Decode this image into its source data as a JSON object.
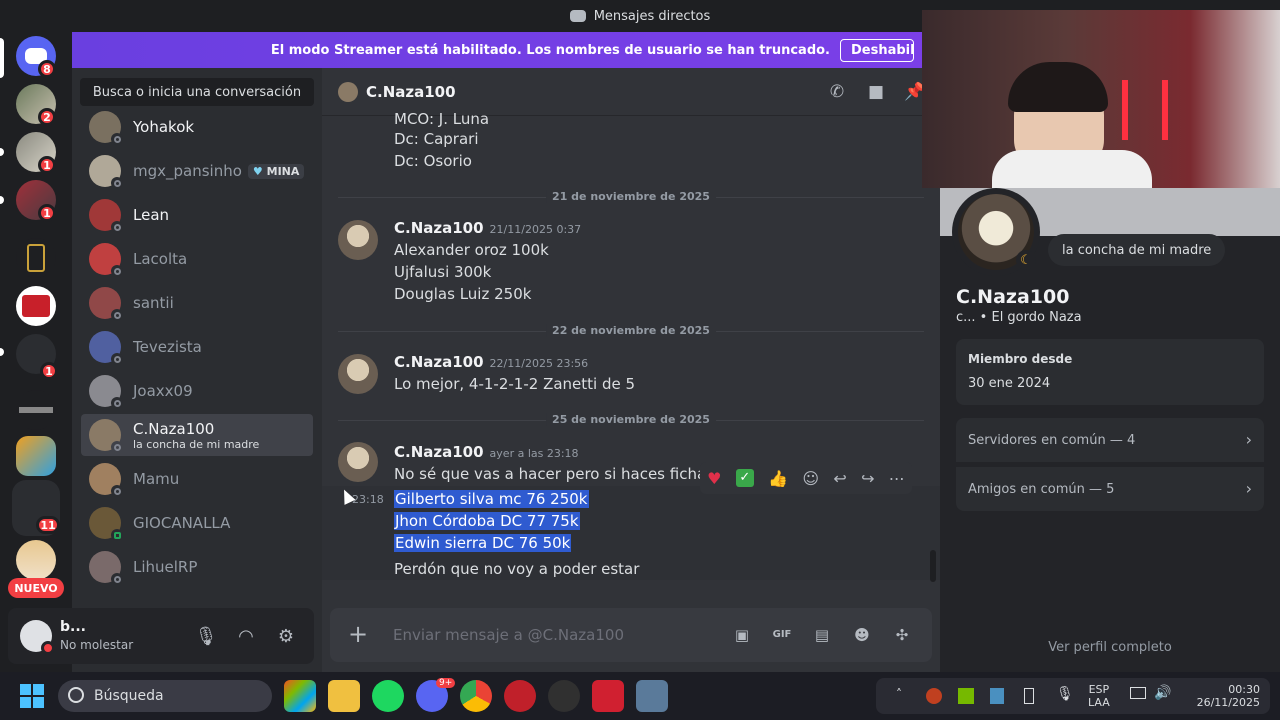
{
  "window": {
    "title": "Mensajes directos"
  },
  "banner": {
    "text": "El modo Streamer está habilitado. Los nombres de usuario se han truncado.",
    "button": "Deshabilit"
  },
  "rail": {
    "badges": [
      "8",
      "2",
      "1",
      "1",
      "1",
      "11"
    ],
    "nuevo": "NUEVO"
  },
  "sidebar": {
    "search_placeholder": "Busca o inicia una conversación",
    "dms": [
      {
        "name": "Yohakok",
        "sub": "",
        "badge": ""
      },
      {
        "name": "mgx_pansinho",
        "sub": "",
        "badge": "MINA"
      },
      {
        "name": "Lean",
        "sub": "",
        "badge": ""
      },
      {
        "name": "Lacolta",
        "sub": "",
        "badge": ""
      },
      {
        "name": "santii",
        "sub": "",
        "badge": ""
      },
      {
        "name": "Tevezista",
        "sub": "",
        "badge": ""
      },
      {
        "name": "Joaxx09",
        "sub": "",
        "badge": ""
      },
      {
        "name": "C.Naza100",
        "sub": "la concha de mi madre",
        "badge": ""
      },
      {
        "name": "Mamu",
        "sub": "",
        "badge": ""
      },
      {
        "name": "GIOCANALLA",
        "sub": "",
        "badge": ""
      },
      {
        "name": "LihuelRP",
        "sub": "",
        "badge": ""
      }
    ],
    "user": {
      "name": "b...",
      "status": "No molestar"
    }
  },
  "chat": {
    "header_name": "C.Naza100",
    "top_lines": [
      "MCO: J. Luna",
      "Dc: Caprari",
      "Dc: Osorio"
    ],
    "dividers": [
      "21 de noviembre de 2025",
      "22 de noviembre de 2025",
      "25 de noviembre de 2025"
    ],
    "messages": [
      {
        "author": "C.Naza100",
        "time": "21/11/2025 0:37",
        "lines": [
          "Alexander oroz 100k",
          "Ujfalusi 300k",
          "Douglas Luiz 250k"
        ]
      },
      {
        "author": "C.Naza100",
        "time": "22/11/2025 23:56",
        "lines": [
          "Lo mejor, 4-1-2-1-2 Zanetti de 5"
        ]
      },
      {
        "author": "C.Naza100",
        "time": "ayer a las 23:18",
        "lines": [
          "No sé que vas a hacer pero si haces fichajes a"
        ]
      }
    ],
    "followup_time": "23:18",
    "selected_lines": [
      "Gilberto silva mc 76 250k",
      "Jhon Córdoba DC 77 75k",
      "Edwin sierra DC 76 50k"
    ],
    "last_line": "Perdón que no voy a poder estar",
    "composer_placeholder": "Enviar mensaje a @C.Naza100"
  },
  "profile": {
    "status": "la concha de mi madre",
    "name": "C.Naza100",
    "subtitle": "c... • El gordo Naza",
    "member_since_label": "Miembro desde",
    "member_since": "30 ene 2024",
    "servers": "Servidores en común — 4",
    "friends": "Amigos en común — 5",
    "full_profile": "Ver perfil completo"
  },
  "taskbar": {
    "search": "Búsqueda",
    "lang_top": "ESP",
    "lang_bottom": "LAA",
    "time": "00:30",
    "date": "26/11/2025",
    "discord_badge": "9+"
  }
}
